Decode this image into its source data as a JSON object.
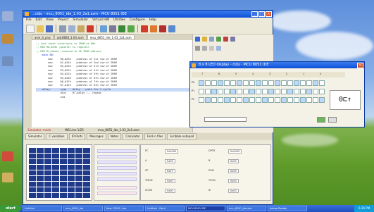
{
  "main_window": {
    "title": "...cidu - mcu_8051_ide_1.03_2a1.asm - MCU 8051 IDE",
    "menu": [
      "File",
      "Edit",
      "View",
      "Project",
      "Simulator",
      "Virtual HW",
      "Utilities",
      "Configure",
      "Help"
    ],
    "tabs": [
      "asm_4_proj",
      "adc0808_1.03.asm",
      "mcu_8051_ide_1.03_2a1.asm"
    ],
    "code_lines": [
      {
        "cls": "cm",
        "text": ";; Just reset interrupts to IRAM as 00h"
      },
      {
        "cls": "cm",
        "text": ";; MOV R0,#25h ;pointer to register"
      },
      {
        "cls": "cm",
        "text": ";; MOV R1,#data ;indexed to 16 IRAM address"
      },
      {
        "cls": "",
        "text": ""
      },
      {
        "cls": "kw",
        "text": "    main_00:"
      },
      {
        "cls": "",
        "text": "        mov     R0,#25h   ;address of 1st row of IRAM"
      },
      {
        "cls": "",
        "text": "        mov     R1,#24h   ;address of 2nd row of IRAM"
      },
      {
        "cls": "",
        "text": "        mov     R2,#23h   ;address of 3rd row of IRAM"
      },
      {
        "cls": "",
        "text": "        mov     R3,#22h   ;address of 4th row of IRAM"
      },
      {
        "cls": "",
        "text": "        mov     R4,#21h   ;address of 5th row of IRAM"
      },
      {
        "cls": "",
        "text": "        mov     R5,#20h   ;address of 6th row of IRAM"
      },
      {
        "cls": "",
        "text": "        mov     R6,#1Fh   ;address of 7th row of IRAM"
      },
      {
        "cls": "",
        "text": "        mov     R7,#1Eh   ;address of 8th row of IRAM"
      },
      {
        "cls": "",
        "text": ""
      },
      {
        "cls": "",
        "text": ""
      },
      {
        "cls": "hl",
        "text": "    delay:      sjmp    delay   ;wait for 1 cycle"
      },
      {
        "cls": "",
        "text": "                djnz    R7,delay ;...repeat"
      },
      {
        "cls": "",
        "text": "                end"
      }
    ],
    "status": {
      "mode": "Simulator: mode",
      "line_info": "INS  Line 1/25",
      "file": "mcu_8051_ide_1.03_2a1.asm"
    },
    "bottom_tabs": [
      "Simulator",
      "C variables",
      "IO Ports",
      "Messages",
      "Notes",
      "Calculator",
      "Find in files",
      "Scribble notepad"
    ],
    "sfr_labels": [
      "PC",
      "DPTR",
      "A",
      "B",
      "SP",
      "PSW",
      "TMOD",
      "TCON",
      "SCON",
      "IE"
    ],
    "sfr_values": [
      "0x0000",
      "0x0000",
      "0x00",
      "0x00",
      "0x07",
      "0x00",
      "0x00",
      "0x00",
      "0x00",
      "0x00"
    ]
  },
  "bit_window": {
    "title": "8 x 8 LED display - cidu - MCU 8051 IDE",
    "header": [
      "7",
      "6",
      "5",
      "4",
      "3",
      "2",
      "1",
      "0"
    ],
    "rows": [
      "P0",
      "P1",
      "P2"
    ],
    "digits": "0⊏↑"
  },
  "taskbar": {
    "start": "start",
    "tasks": [
      "Untitled",
      "mcu_8051_ide",
      "New CS105 .doc",
      "Untitled - Paint",
      "MCU 8051 IDE",
      "mcu_8051_ide.doc",
      "Adobe Reader"
    ],
    "active_index": 4,
    "clock": "6:34 PM"
  }
}
